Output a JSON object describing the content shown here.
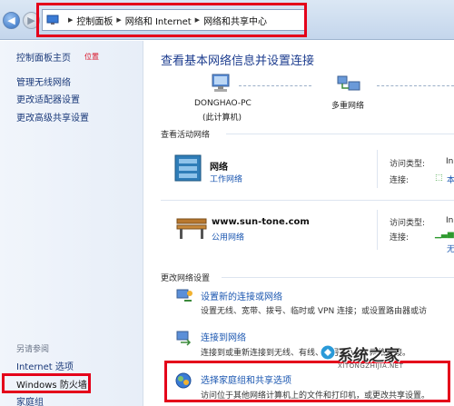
{
  "address_bar": {
    "crumbs": [
      "控制面板",
      "网络和 Internet",
      "网络和共享中心"
    ]
  },
  "sidebar": {
    "home": "控制面板主页",
    "position_hint": "位置",
    "items": [
      "管理无线网络",
      "更改适配器设置",
      "更改高级共享设置"
    ],
    "see_also_heading": "另请参阅",
    "see_also": [
      "Internet 选项",
      "Windows 防火墙",
      "家庭组"
    ]
  },
  "main": {
    "title": "查看基本网络信息并设置连接",
    "computer_name": "DONGHAO-PC",
    "computer_sub": "(此计算机)",
    "network_node": "多重网络",
    "active_heading": "查看活动网络",
    "networks": [
      {
        "name": "网络",
        "type": "工作网络",
        "access_label": "访问类型:",
        "access_value": "In",
        "conn_label": "连接:",
        "conn_value": "本"
      },
      {
        "name": "www.sun-tone.com",
        "type": "公用网络",
        "access_label": "访问类型:",
        "access_value": "In",
        "conn_label": "连接:",
        "conn_value": "无"
      }
    ],
    "change_heading": "更改网络设置",
    "tasks": [
      {
        "title": "设置新的连接或网络",
        "desc": "设置无线、宽带、拨号、临时或 VPN 连接；或设置路由器或访"
      },
      {
        "title": "连接到网络",
        "desc": "连接到或重新连接到无线、有线、拨号或 VPN 网络连接。"
      },
      {
        "title": "选择家庭组和共享选项",
        "desc": "访问位于其他网络计算机上的文件和打印机，或更改共享设置。"
      }
    ]
  },
  "watermark": {
    "text": "系统之家",
    "sub": "XITONGZHIJIA.NET"
  },
  "colors": {
    "highlight": "#e4001a",
    "link": "#1a56b0",
    "title": "#1d3d8f"
  }
}
